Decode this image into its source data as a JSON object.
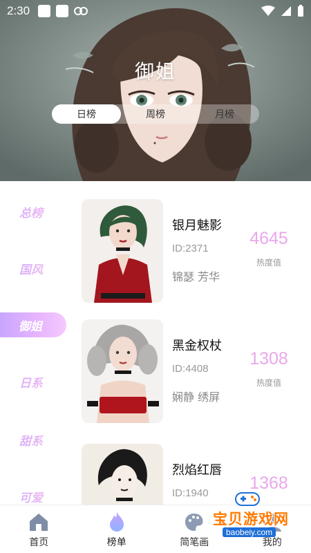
{
  "status": {
    "time": "2:30"
  },
  "header": {
    "title": "御姐",
    "tabs": [
      {
        "label": "日榜",
        "active": true
      },
      {
        "label": "周榜",
        "active": false
      },
      {
        "label": "月榜",
        "active": false
      }
    ]
  },
  "sidebar": {
    "items": [
      {
        "label": "总榜",
        "active": false
      },
      {
        "label": "国风",
        "active": false
      },
      {
        "label": "御姐",
        "active": true
      },
      {
        "label": "日系",
        "active": false
      },
      {
        "label": "甜系",
        "active": false
      },
      {
        "label": "可爱",
        "active": false
      }
    ]
  },
  "list": {
    "heat_label": "热度值",
    "items": [
      {
        "name": "银月魅影",
        "id": "ID:2371",
        "tags": "锦瑟  芳华",
        "heat": "4645"
      },
      {
        "name": "黑金权杖",
        "id": "ID:4408",
        "tags": "娴静  绣屏",
        "heat": "1308"
      },
      {
        "name": "烈焰红唇",
        "id": "ID:1940",
        "tags": "",
        "heat": "1368"
      }
    ]
  },
  "bottom_nav": {
    "items": [
      {
        "label": "首页",
        "icon": "home-icon",
        "active": false
      },
      {
        "label": "榜单",
        "icon": "flame-icon",
        "active": true
      },
      {
        "label": "简笔画",
        "icon": "palette-icon",
        "active": false
      },
      {
        "label": "我的",
        "icon": "user-icon",
        "active": false
      }
    ]
  },
  "watermark": {
    "text": "宝贝游戏网",
    "url": "baobeiy.com"
  },
  "colors": {
    "accent_pink": "#e9a8ea",
    "accent_purple": "#c8a6ff"
  }
}
